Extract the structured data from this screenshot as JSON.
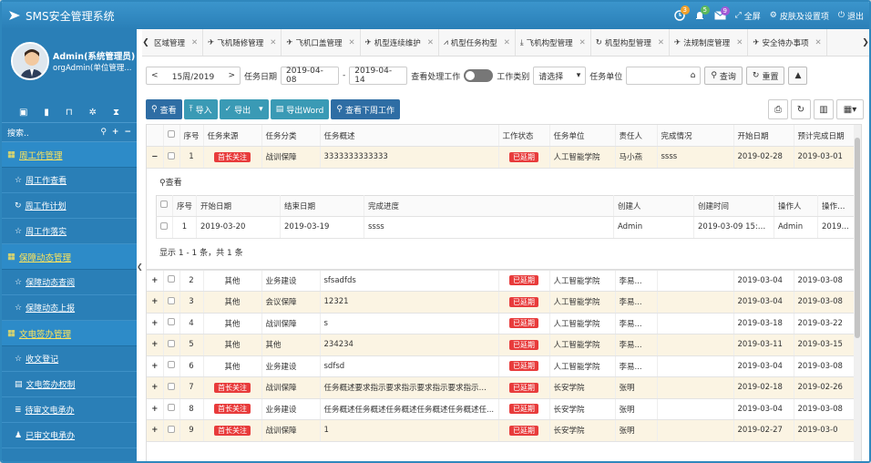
{
  "app": {
    "title": "SMS安全管理系统"
  },
  "topbar": {
    "items": [
      {
        "icon": "clock-icon",
        "badge": "3",
        "badge_color": "#f0a02a",
        "label": ""
      },
      {
        "icon": "bell-icon",
        "badge": "5",
        "badge_color": "#5cb85c",
        "label": ""
      },
      {
        "icon": "mail-icon",
        "badge": "9",
        "badge_color": "#a25ad6",
        "label": ""
      }
    ],
    "fullscreen": "全屏",
    "skin": "皮肤及设置项",
    "logout": "退出"
  },
  "user": {
    "name": "Admin(系统管理员)",
    "org": "orgAdmin(单位管理..."
  },
  "sidebar": {
    "search_label": "搜索..",
    "groups": [
      {
        "label": "周工作管理",
        "items": [
          "周工作查看",
          "周工作计划",
          "周工作落实"
        ]
      },
      {
        "label": "保障动态管理",
        "items": [
          "保障动态查阅",
          "保障动态上报"
        ]
      },
      {
        "label": "文电签办管理",
        "items": [
          "收文登记",
          "文电签办权制",
          "待审文电承办",
          "已审文电承办"
        ]
      }
    ]
  },
  "tabs": [
    "区域管理",
    "飞机随修管理",
    "飞机口盖管理",
    "机型连续维护",
    "机型任务构型",
    "飞机构型管理",
    "机型构型管理",
    "法规制度管理",
    "安全待办事项"
  ],
  "filters": {
    "prev": "<",
    "week": "15周/2019",
    "next": ">",
    "date_label": "任务日期",
    "date_from": "2019-04-08",
    "date_sep": "-",
    "date_to": "2019-04-14",
    "show_done_label": "查看处理工作",
    "work_type_label": "工作类别",
    "work_type_value": "请选择",
    "task_unit_label": "任务单位",
    "task_unit_value": "",
    "query": "查询",
    "reset": "重置",
    "collapse": "▲"
  },
  "toolbar": {
    "view": "查看",
    "import": "导入",
    "export": "导出",
    "export_word": "导出Word",
    "view_next_week": "查看下周工作"
  },
  "table": {
    "headers": [
      "序号",
      "任务来源",
      "任务分类",
      "任务概述",
      "工作状态",
      "任务单位",
      "责任人",
      "完成情况",
      "开始日期",
      "预计完成日期"
    ],
    "rows": [
      {
        "expand": "−",
        "no": "1",
        "source": "首长关注",
        "category": "战训保障",
        "desc": "3333333333333",
        "status": "已延期",
        "unit": "人工智能学院",
        "owner": "马小燕",
        "done": "ssss",
        "start": "2019-02-28",
        "end": "2019-03-01",
        "alt": true
      },
      {
        "expand": "+",
        "no": "2",
        "source": "其他",
        "category": "业务建设",
        "desc": "sfsadfds",
        "status": "已延期",
        "unit": "人工智能学院",
        "owner": "李易...",
        "done": "",
        "start": "2019-03-04",
        "end": "2019-03-08",
        "alt": false
      },
      {
        "expand": "+",
        "no": "3",
        "source": "其他",
        "category": "会议保障",
        "desc": "12321",
        "status": "已延期",
        "unit": "人工智能学院",
        "owner": "李易...",
        "done": "",
        "start": "2019-03-04",
        "end": "2019-03-08",
        "alt": true
      },
      {
        "expand": "+",
        "no": "4",
        "source": "其他",
        "category": "战训保障",
        "desc": "s",
        "status": "已延期",
        "unit": "人工智能学院",
        "owner": "李易...",
        "done": "",
        "start": "2019-03-18",
        "end": "2019-03-22",
        "alt": false
      },
      {
        "expand": "+",
        "no": "5",
        "source": "其他",
        "category": "其他",
        "desc": "234234",
        "status": "已延期",
        "unit": "人工智能学院",
        "owner": "李易...",
        "done": "",
        "start": "2019-03-11",
        "end": "2019-03-15",
        "alt": true
      },
      {
        "expand": "+",
        "no": "6",
        "source": "其他",
        "category": "业务建设",
        "desc": "sdfsd",
        "status": "已延期",
        "unit": "人工智能学院",
        "owner": "李易...",
        "done": "",
        "start": "2019-03-04",
        "end": "2019-03-08",
        "alt": false
      },
      {
        "expand": "+",
        "no": "7",
        "source": "首长关注",
        "category": "战训保障",
        "desc": "任务概述要求指示要求指示要求指示要求指示要求指...",
        "status": "已延期",
        "unit": "长安学院",
        "owner": "张明",
        "done": "",
        "start": "2019-02-18",
        "end": "2019-02-26",
        "alt": true
      },
      {
        "expand": "+",
        "no": "8",
        "source": "首长关注",
        "category": "业务建设",
        "desc": "任务概述任务概述任务概述任务概述任务概述任...",
        "status": "已延期",
        "unit": "长安学院",
        "owner": "张明",
        "done": "",
        "start": "2019-03-04",
        "end": "2019-03-08",
        "alt": false
      },
      {
        "expand": "+",
        "no": "9",
        "source": "首长关注",
        "category": "战训保障",
        "desc": "1",
        "status": "已延期",
        "unit": "长安学院",
        "owner": "张明",
        "done": "",
        "start": "2019-02-27",
        "end": "2019-03-0",
        "alt": true
      }
    ]
  },
  "subtable": {
    "view": "查看",
    "headers": [
      "序号",
      "开始日期",
      "结束日期",
      "完成进度",
      "创建人",
      "创建时间",
      "操作人",
      "操作时间"
    ],
    "row": {
      "no": "1",
      "start": "2019-03-20",
      "end": "2019-03-19",
      "progress": "ssss",
      "creator": "Admin",
      "created": "2019-03-09 15:42...",
      "operator": "Admin",
      "optime": "2019..."
    },
    "footer": "显示 1 - 1 条，共 1 条"
  },
  "colors": {
    "primary": "#2a7fb7",
    "menu_group": "#ffe55a",
    "tag": "#e83b3b",
    "alt_row": "#fbf4e3"
  }
}
